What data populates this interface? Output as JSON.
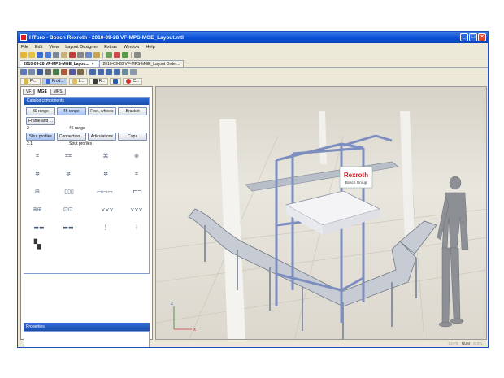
{
  "window": {
    "title": "HTpro - Bosch Rexroth - 2010-09-28 VF-MPS-MGE_Layout.mtl",
    "controls": [
      "_",
      "□",
      "×"
    ]
  },
  "menu": [
    "File",
    "Edit",
    "View",
    "Layout Designer",
    "Extras",
    "Window",
    "Help"
  ],
  "doc_tabs": [
    {
      "label": "2010-09-28 VF-MPS-MGE_Layou...",
      "close": "×",
      "active": true
    },
    {
      "label": "2010-09-28 VF-MPS-MGE_Layout Order...",
      "active": false
    }
  ],
  "panel_tabs": [
    "Pr...",
    "Prod...",
    "L...",
    "R...",
    "C..."
  ],
  "left_tabs": [
    "VF",
    "MGE",
    "MPS"
  ],
  "catalog": {
    "header": "Catalog components",
    "row1": [
      "30 range",
      "45 range",
      "Feet, wheels",
      "Bracket"
    ],
    "row2": [
      "Frame and ..."
    ],
    "range_num": "2",
    "range_label": "45 range",
    "row3": [
      "Strut profiles",
      "Connection...",
      "Articulations",
      "Caps"
    ],
    "sub_num": "2.1",
    "sub_label": "Strut profiles"
  },
  "properties": {
    "header": "Properties"
  },
  "viewport": {
    "sign_brand": "Rexroth",
    "sign_sub": "Bosch Group",
    "axes": [
      "z",
      "x"
    ]
  },
  "status": [
    "CAPS",
    "NUM",
    "SCRL"
  ]
}
